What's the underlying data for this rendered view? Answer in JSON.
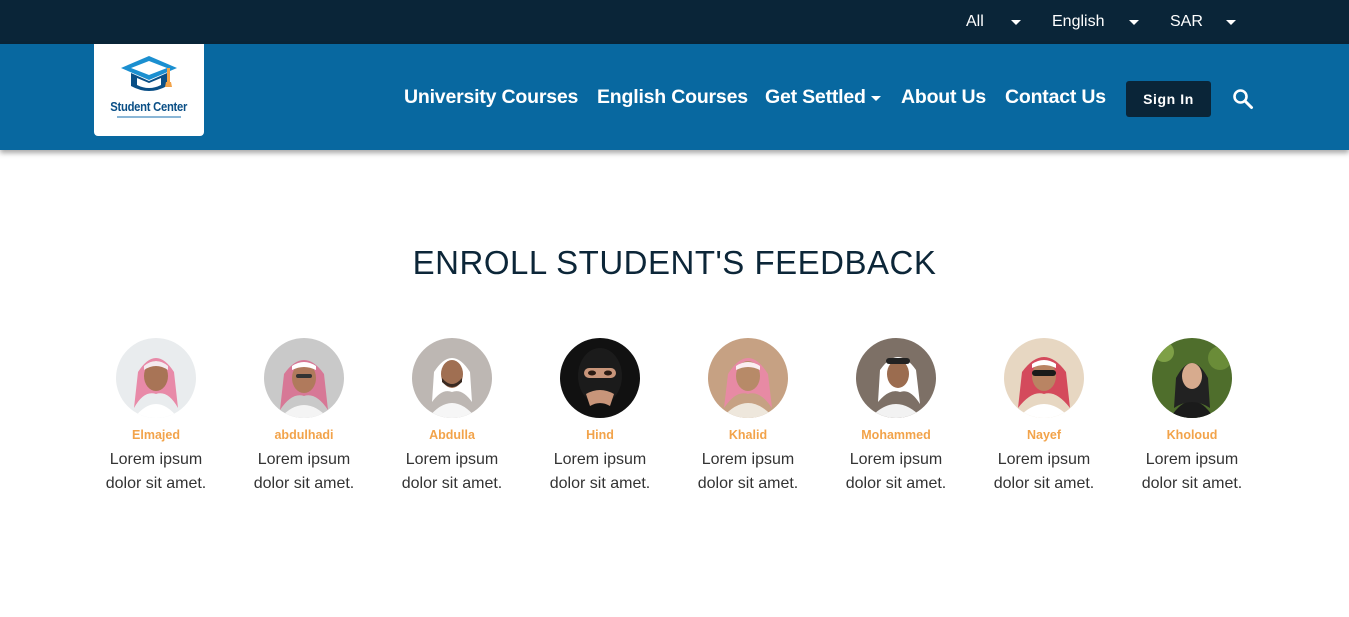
{
  "topbar": {
    "filter_label": "All",
    "language_label": "English",
    "currency_label": "SAR"
  },
  "logo": {
    "text": "Student Center"
  },
  "nav": {
    "items": [
      {
        "label": "University Courses"
      },
      {
        "label": "English Courses"
      },
      {
        "label": "Get Settled"
      },
      {
        "label": "About Us"
      },
      {
        "label": "Contact Us"
      }
    ],
    "signin_label": "Sign In"
  },
  "feedback": {
    "heading": "ENROLL STUDENT'S FEEDBACK",
    "students": [
      {
        "name": "Elmajed",
        "text": "Lorem ipsum dolor sit amet."
      },
      {
        "name": "abdulhadi",
        "text": "Lorem ipsum dolor sit amet."
      },
      {
        "name": "Abdulla",
        "text": "Lorem ipsum dolor sit amet."
      },
      {
        "name": "Hind",
        "text": "Lorem ipsum dolor sit amet."
      },
      {
        "name": "Khalid",
        "text": "Lorem ipsum dolor sit amet."
      },
      {
        "name": "Mohammed",
        "text": "Lorem ipsum dolor sit amet."
      },
      {
        "name": "Nayef",
        "text": "Lorem ipsum dolor sit amet."
      },
      {
        "name": "Kholoud",
        "text": "Lorem ipsum dolor sit amet."
      }
    ]
  },
  "colors": {
    "topbar": "#0a2538",
    "navbar": "#0868a0",
    "accent_name": "#f2a34a",
    "heading": "#0c2638"
  },
  "icons": {
    "search": "search-icon",
    "dropdown": "caret-down-icon",
    "logo": "graduation-cap-logo"
  }
}
